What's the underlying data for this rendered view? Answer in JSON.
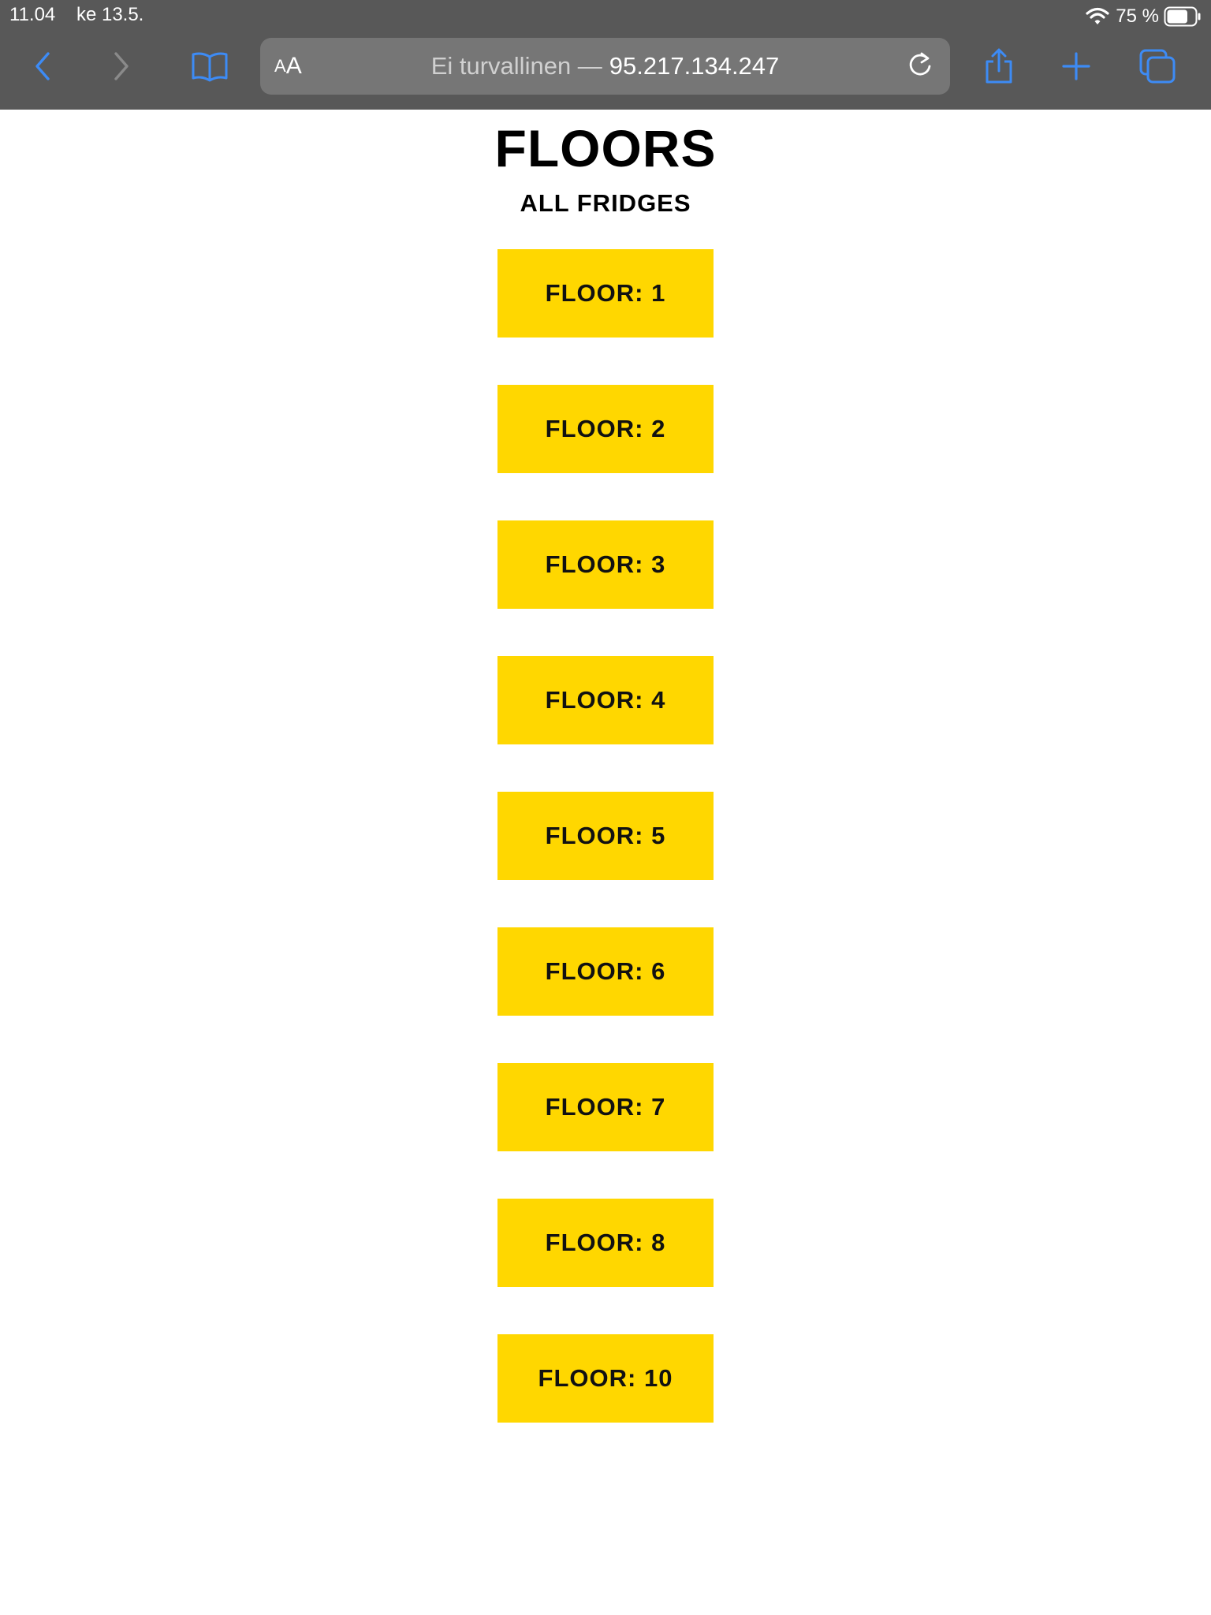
{
  "status_bar": {
    "time": "11.04",
    "date": "ke 13.5.",
    "battery_percent": "75 %",
    "battery_level": 0.75
  },
  "browser": {
    "text_size_small": "A",
    "text_size_big": "A",
    "url_prefix": "Ei turvallinen —",
    "url_host": "95.217.134.247",
    "icons": {
      "back": "chevron-left-icon",
      "forward": "chevron-right-icon",
      "bookmarks": "book-icon",
      "reload": "reload-icon",
      "share": "share-icon",
      "new_tab": "plus-icon",
      "tabs": "tabs-icon"
    },
    "accent_color": "#3d8bf5",
    "chrome_color": "#585858"
  },
  "page": {
    "title": "FLOORS",
    "subtitle": "ALL FRIDGES",
    "button_color": "#ffd700",
    "floors": [
      {
        "label": "FLOOR: 1"
      },
      {
        "label": "FLOOR: 2"
      },
      {
        "label": "FLOOR: 3"
      },
      {
        "label": "FLOOR: 4"
      },
      {
        "label": "FLOOR: 5"
      },
      {
        "label": "FLOOR: 6"
      },
      {
        "label": "FLOOR: 7"
      },
      {
        "label": "FLOOR: 8"
      },
      {
        "label": "FLOOR: 10"
      }
    ]
  }
}
